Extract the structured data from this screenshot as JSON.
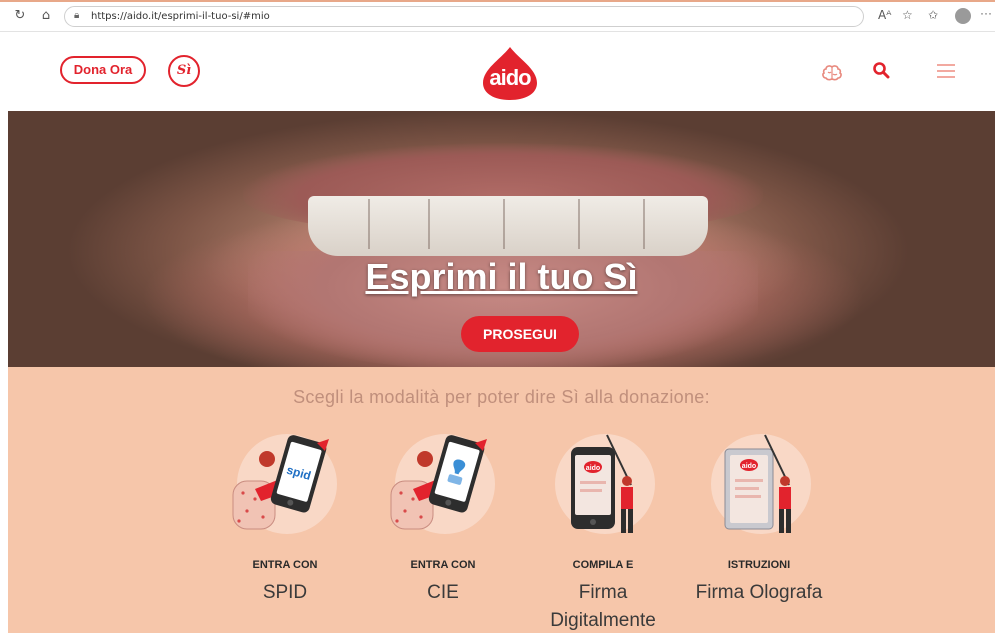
{
  "browser": {
    "url": "https://aido.it/esprimi-il-tuo-si/#mio",
    "back_icon": "reload-icon",
    "home_icon": "home-icon",
    "read_aloud": "Aᴬ",
    "more": "···"
  },
  "header": {
    "dona_label": "Dona Ora",
    "si_label": "Sì",
    "logo_text": "aido",
    "colors": {
      "brand_red": "#e2232d",
      "peach": "#f6c6aa"
    }
  },
  "hero": {
    "title": "Esprimi il tuo Sì",
    "cta_label": "PROSEGUI"
  },
  "chooser": {
    "title": "Scegli la modalità per poter dire Sì alla donazione:",
    "options": [
      {
        "label": "ENTRA CON",
        "sub": "SPID",
        "icon": "spid-phone-illustration",
        "phone_text": "spid"
      },
      {
        "label": "ENTRA CON",
        "sub": "CIE",
        "icon": "cie-phone-illustration"
      },
      {
        "label": "COMPILA E",
        "sub": "Firma Digitalmente",
        "icon": "sign-digitally-illustration",
        "phone_text": "aido"
      },
      {
        "label": "ISTRUZIONI",
        "sub": "Firma Olografa",
        "icon": "handwritten-signature-illustration",
        "phone_text": "aido"
      }
    ]
  }
}
